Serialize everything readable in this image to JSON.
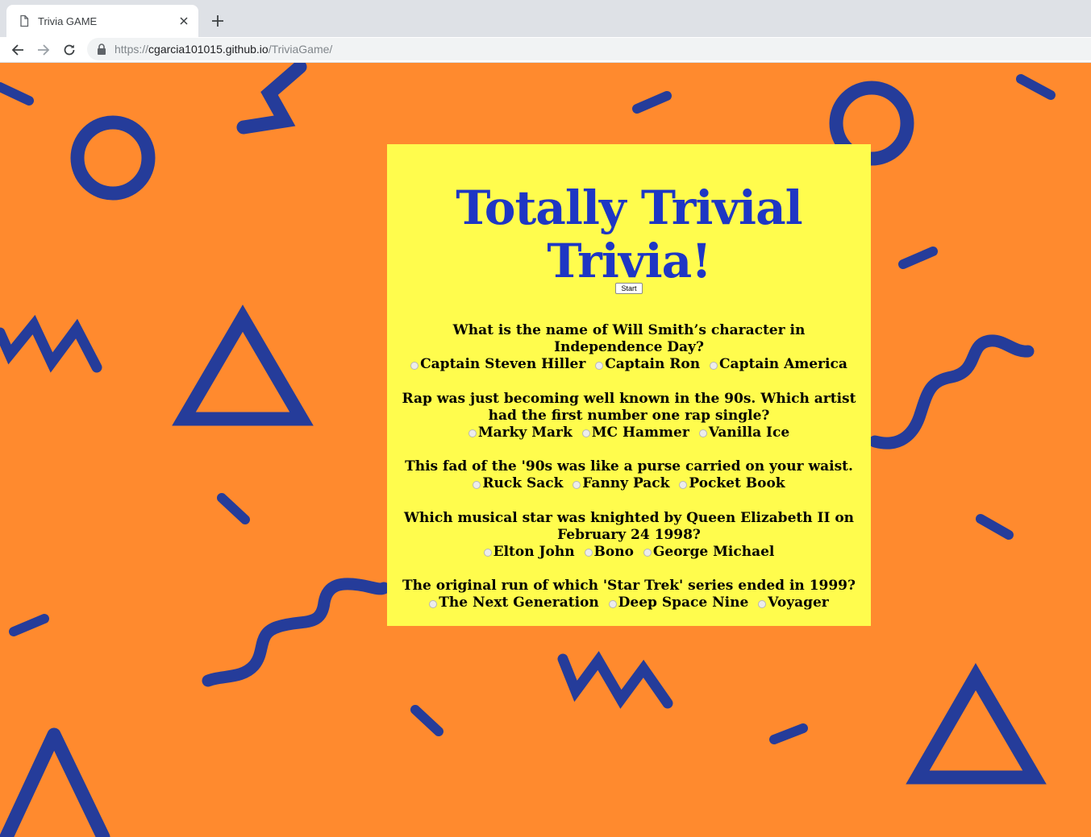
{
  "browser": {
    "tab_title": "Trivia GAME",
    "url_scheme": "https://",
    "url_host": "cgarcia101015.github.io",
    "url_path": "/TriviaGame/"
  },
  "page": {
    "title": "Totally Trivial Trivia!",
    "start_label": "Start",
    "colors": {
      "background": "#ff8a2e",
      "card": "#fffc4d",
      "title": "#1e36c4",
      "shapes": "#253c9a"
    }
  },
  "questions": [
    {
      "text": "What is the name of Will Smith’s character in Independence Day?",
      "options": [
        "Captain Steven Hiller",
        "Captain Ron",
        "Captain America"
      ]
    },
    {
      "text": "Rap was just becoming well known in the 90s. Which artist had the first number one rap single?",
      "options": [
        "Marky Mark",
        "MC Hammer",
        "Vanilla Ice"
      ]
    },
    {
      "text": "This fad of the '90s was like a purse carried on your waist.",
      "options": [
        "Ruck Sack",
        "Fanny Pack",
        "Pocket Book"
      ]
    },
    {
      "text": "Which musical star was knighted by Queen Elizabeth II on February 24 1998?",
      "options": [
        "Elton John",
        "Bono",
        "George Michael"
      ]
    },
    {
      "text": "The original run of which 'Star Trek' series ended in 1999?",
      "options": [
        "The Next Generation",
        "Deep Space Nine",
        "Voyager"
      ]
    }
  ]
}
